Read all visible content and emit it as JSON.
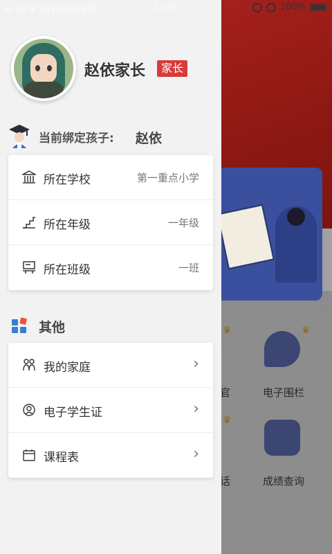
{
  "status_bar": {
    "left": "ıııl ıııl 令 30 KB/s VoLTE",
    "time": "12:09",
    "battery": "100%"
  },
  "profile": {
    "name": "赵依家长",
    "role": "家长"
  },
  "child": {
    "label": "当前绑定孩子:",
    "name": "赵依"
  },
  "info_card": [
    {
      "label": "所在学校",
      "value": "第一重点小学"
    },
    {
      "label": "所在年级",
      "value": "一年级"
    },
    {
      "label": "所在班级",
      "value": "一班"
    }
  ],
  "other": {
    "title": "其他",
    "items": [
      {
        "label": "我的家庭"
      },
      {
        "label": "电子学生证"
      },
      {
        "label": "课程表"
      }
    ]
  },
  "background": {
    "items": [
      {
        "label": "官"
      },
      {
        "label": "电子围栏"
      },
      {
        "label": "话"
      },
      {
        "label": "成绩查询"
      }
    ]
  },
  "colors": {
    "accent_red": "#d93a3a",
    "drawer_bg": "#f2f2f2"
  }
}
